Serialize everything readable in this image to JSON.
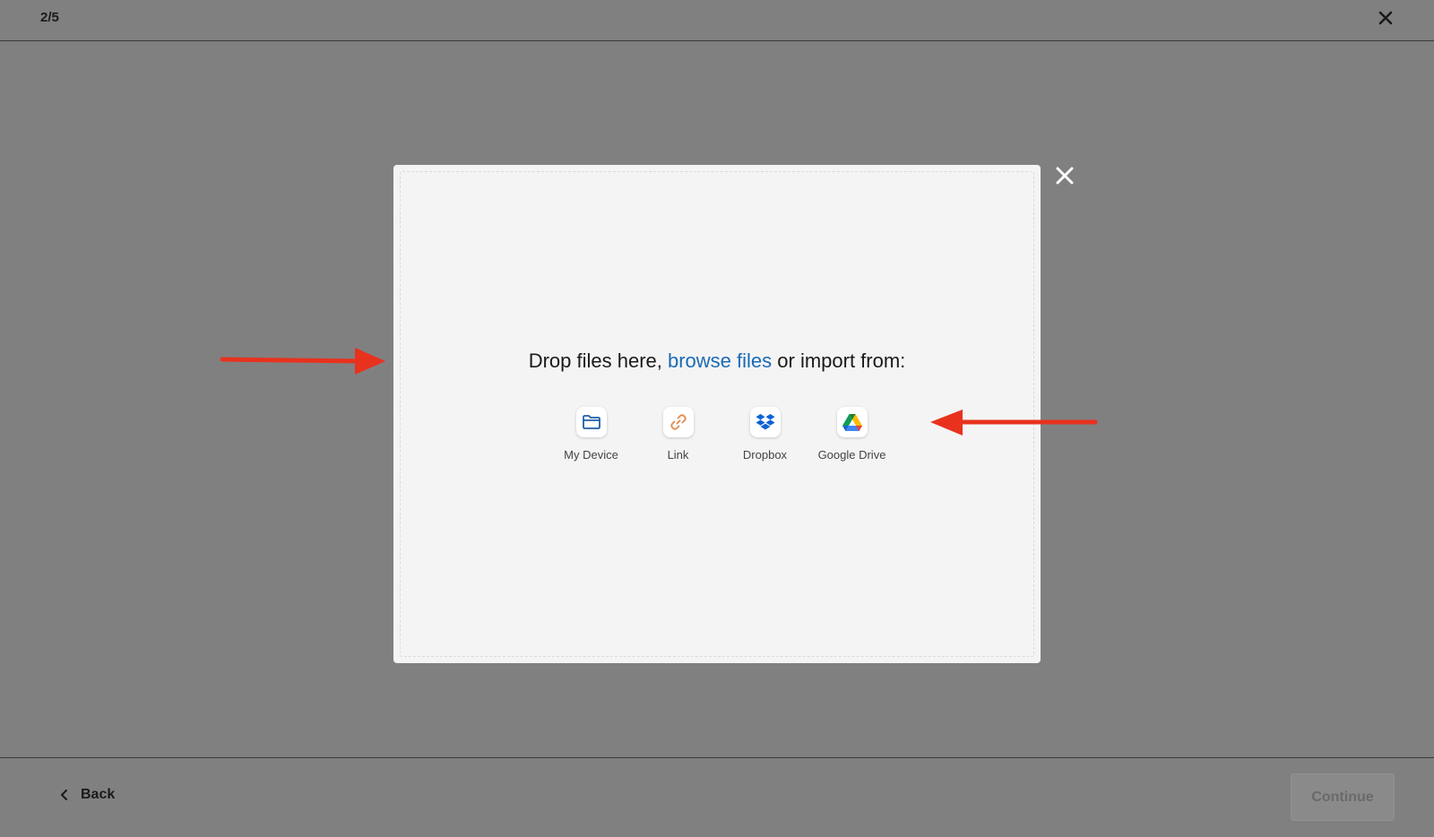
{
  "header": {
    "step": "2/5",
    "close_icon": "close-icon"
  },
  "modal": {
    "close_icon": "close-icon",
    "headline_prefix": "Drop files here, ",
    "browse_link": "browse files",
    "headline_suffix": " or import from:",
    "sources": [
      {
        "label": "My Device",
        "icon": "folder-icon"
      },
      {
        "label": "Link",
        "icon": "link-icon"
      },
      {
        "label": "Dropbox",
        "icon": "dropbox-icon"
      },
      {
        "label": "Google Drive",
        "icon": "google-drive-icon"
      }
    ]
  },
  "footer": {
    "back_label": "Back",
    "back_icon": "chevron-left-icon",
    "continue_label": "Continue"
  },
  "colors": {
    "overlay": "#808080",
    "modal_bg": "#f4f4f4",
    "link": "#1a6bb5",
    "annotation_arrow": "#e8321e"
  }
}
